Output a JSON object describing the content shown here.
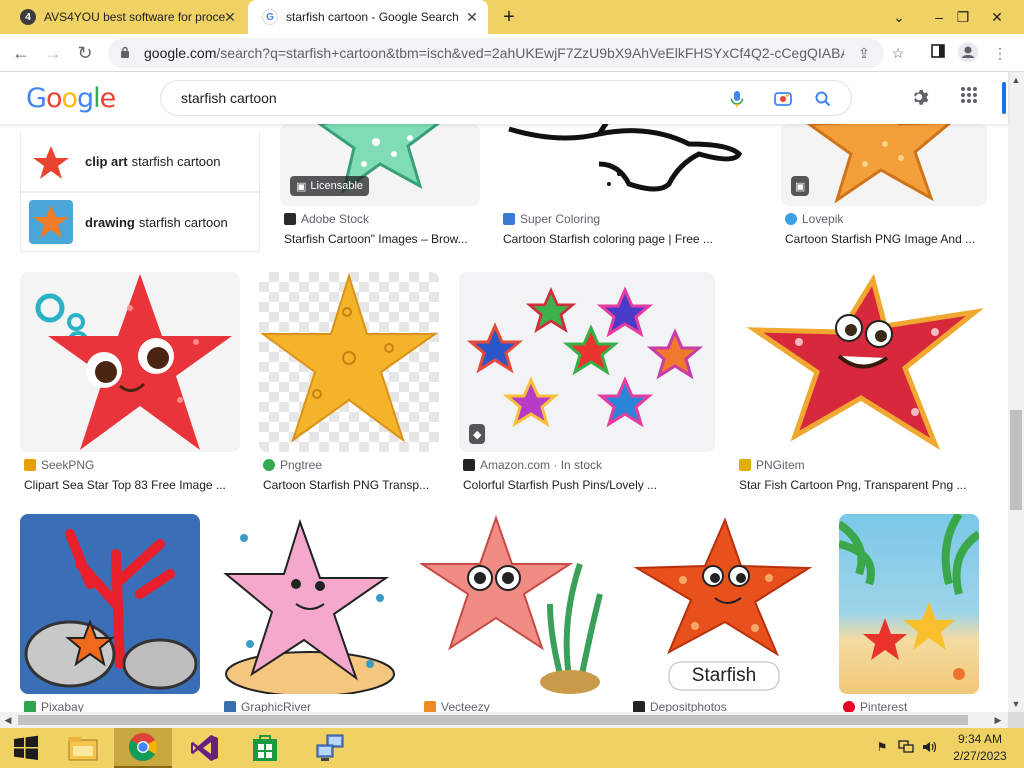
{
  "browser": {
    "tabs": [
      {
        "title": "AVS4YOU best software for proce",
        "favicon_text": "4"
      },
      {
        "title": "starfish cartoon - Google Search",
        "favicon_text": "G"
      }
    ],
    "url_host": "google.com",
    "url_path": "/search?q=starfish+cartoon&tbm=isch&ved=2ahUKEwjF7ZzU9bX9AhVeElkFHSYxCf4Q2-cCegQIABA...",
    "new_tab": "+",
    "window_controls": [
      "⌄",
      "–",
      "❐",
      "✕"
    ]
  },
  "google": {
    "logo_letters": [
      {
        "ch": "G",
        "color": "#4285f4"
      },
      {
        "ch": "o",
        "color": "#ea4335"
      },
      {
        "ch": "o",
        "color": "#fbbc05"
      },
      {
        "ch": "g",
        "color": "#4285f4"
      },
      {
        "ch": "l",
        "color": "#34a853"
      },
      {
        "ch": "e",
        "color": "#ea4335"
      }
    ],
    "query": "starfish cartoon"
  },
  "related": [
    {
      "bold": "clip art",
      "rest": "starfish cartoon"
    },
    {
      "bold": "drawing",
      "rest": "starfish cartoon"
    }
  ],
  "results_row1": [
    {
      "source": "Adobe Stock",
      "title": "Starfish Cartoon\" Images – Brow...",
      "badge": "Licensable",
      "fav_color": "#2b2b2b"
    },
    {
      "source": "Super Coloring",
      "title": "Cartoon Starfish coloring page | Free ...",
      "fav_color": "#3a7bd5"
    },
    {
      "source": "Lovepik",
      "title": "Cartoon Starfish PNG Image And ...",
      "fav_color": "#3aa0e8"
    }
  ],
  "results_row2": [
    {
      "source": "SeekPNG",
      "title": "Clipart Sea Star Top 83 Free Image ...",
      "fav_color": "#e6a000"
    },
    {
      "source": "Pngtree",
      "title": "Cartoon Starfish PNG Transp...",
      "fav_color": "#34a853"
    },
    {
      "source": "Amazon.com · In stock",
      "title": "Colorful Starfish Push Pins/Lovely ...",
      "fav_color": "#222222"
    },
    {
      "source": "PNGitem",
      "title": "Star Fish Cartoon Png, Transparent Png ...",
      "fav_color": "#e0b000"
    }
  ],
  "results_row3": [
    {
      "source": "Pixabay",
      "fav_color": "#2ea44f"
    },
    {
      "source": "GraphicRiver",
      "fav_color": "#3a6fb0"
    },
    {
      "source": "Vecteezy",
      "fav_color": "#f08a24"
    },
    {
      "source": "Depositphotos",
      "fav_color": "#222222"
    },
    {
      "source": "Pinterest",
      "fav_color": "#e60023"
    }
  ],
  "image_label": "Starfish",
  "taskbar": {
    "time": "9:34 AM",
    "date": "2/27/2023"
  }
}
